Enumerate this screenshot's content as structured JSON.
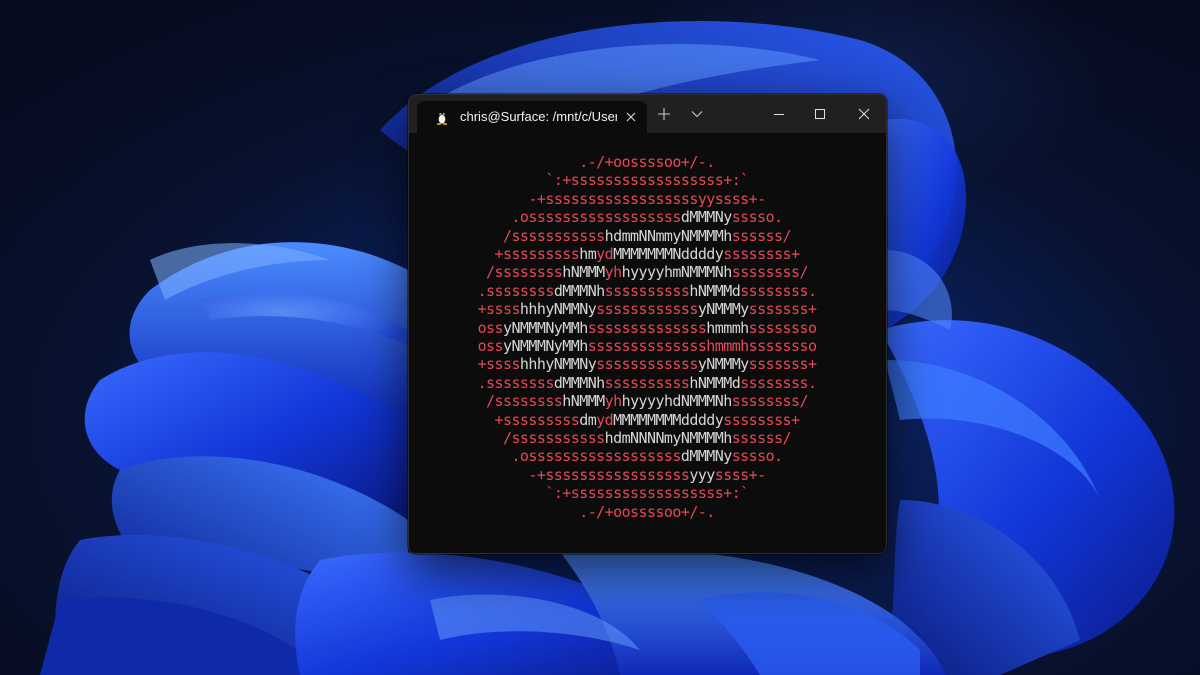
{
  "desktop": {
    "wallpaper": "windows-11-bloom"
  },
  "terminal": {
    "tab_title": "chris@Surface: /mnt/c/Users/c",
    "tab_icon": "linux-penguin-icon",
    "colors": {
      "logo": "#e74856",
      "text": "#d6d6d6",
      "background": "#0c0c0c",
      "titlebar": "#202020"
    },
    "ascii_art": [
      [
        [
          "r",
          ".-/+oossssoo+/-."
        ]
      ],
      [
        [
          "r",
          "`:+ssssssssssssssssss+:`"
        ]
      ],
      [
        [
          "r",
          "-+ssssssssssssssssssyyssss+-"
        ]
      ],
      [
        [
          "r",
          ".ossssssssssssssssss"
        ],
        [
          "w",
          "dMMMNy"
        ],
        [
          "r",
          "sssso."
        ]
      ],
      [
        [
          "r",
          "/sssssssssss"
        ],
        [
          "w",
          "hdmmNNmmyNMMMMh"
        ],
        [
          "r",
          "ssssss/"
        ]
      ],
      [
        [
          "r",
          "+sssssssss"
        ],
        [
          "w",
          "hm"
        ],
        [
          "r",
          "yd"
        ],
        [
          "w",
          "MMMMMMMNddddy"
        ],
        [
          "r",
          "ssssssss+"
        ]
      ],
      [
        [
          "r",
          "/ssssssss"
        ],
        [
          "w",
          "hNMMM"
        ],
        [
          "r",
          "yh"
        ],
        [
          "w",
          "hyyyyhmNMMMNh"
        ],
        [
          "r",
          "ssssssss/"
        ]
      ],
      [
        [
          "r",
          ".ssssssss"
        ],
        [
          "w",
          "dMMMNh"
        ],
        [
          "r",
          "ssssssssss"
        ],
        [
          "w",
          "hNMMMd"
        ],
        [
          "r",
          "ssssssss."
        ]
      ],
      [
        [
          "r",
          "+ssss"
        ],
        [
          "w",
          "hhhyNMMNy"
        ],
        [
          "r",
          "ssssssssssss"
        ],
        [
          "w",
          "yNMMMy"
        ],
        [
          "r",
          "sssssss+"
        ]
      ],
      [
        [
          "r",
          "oss"
        ],
        [
          "w",
          "yNMMMNyMMh"
        ],
        [
          "r",
          "ssssssssssssss"
        ],
        [
          "w",
          "hmmmh"
        ],
        [
          "r",
          "ssssssso"
        ]
      ],
      [
        [
          "r",
          "oss"
        ],
        [
          "w",
          "yNMMMNyMMh"
        ],
        [
          "r",
          "sssssssssssssshmmmhssssssso"
        ]
      ],
      [
        [
          "r",
          "+ssss"
        ],
        [
          "w",
          "hhhyNMMNy"
        ],
        [
          "r",
          "ssssssssssss"
        ],
        [
          "w",
          "yNMMMy"
        ],
        [
          "r",
          "sssssss+"
        ]
      ],
      [
        [
          "r",
          ".ssssssss"
        ],
        [
          "w",
          "dMMMNh"
        ],
        [
          "r",
          "ssssssssss"
        ],
        [
          "w",
          "hNMMMd"
        ],
        [
          "r",
          "ssssssss."
        ]
      ],
      [
        [
          "r",
          "/ssssssss"
        ],
        [
          "w",
          "hNMMM"
        ],
        [
          "r",
          "yh"
        ],
        [
          "w",
          "hyyyyhdNMMMNh"
        ],
        [
          "r",
          "ssssssss/"
        ]
      ],
      [
        [
          "r",
          "+sssssssss"
        ],
        [
          "w",
          "dm"
        ],
        [
          "r",
          "yd"
        ],
        [
          "w",
          "MMMMMMMMddddy"
        ],
        [
          "r",
          "ssssssss+"
        ]
      ],
      [
        [
          "r",
          "/sssssssssss"
        ],
        [
          "w",
          "hdmNNNNmyNMMMMh"
        ],
        [
          "r",
          "ssssss/"
        ]
      ],
      [
        [
          "r",
          ".ossssssssssssssssss"
        ],
        [
          "w",
          "dMMMNy"
        ],
        [
          "r",
          "sssso."
        ]
      ],
      [
        [
          "r",
          "-+sssssssssssssssss"
        ],
        [
          "w",
          "yyy"
        ],
        [
          "r",
          "ssss+-"
        ]
      ],
      [
        [
          "r",
          "`:+ssssssssssssssssss+:`"
        ]
      ],
      [
        [
          "r",
          ".-/+oossssoo+/-."
        ]
      ]
    ]
  }
}
